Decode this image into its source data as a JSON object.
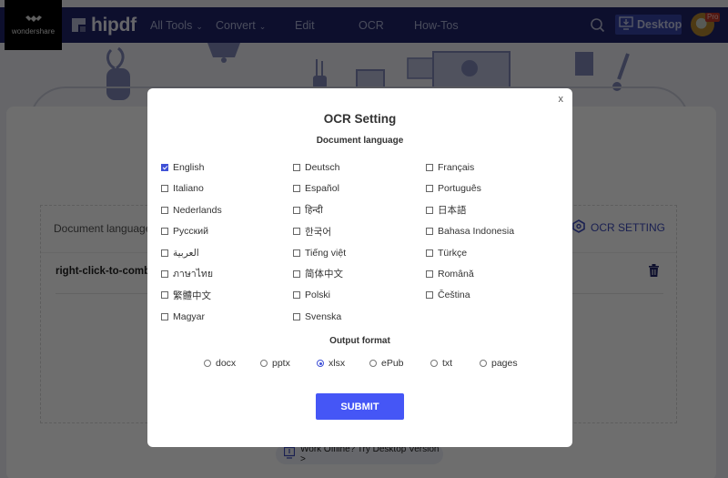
{
  "topbar": {
    "company_logo_text": "wondershare",
    "brand_name": "hipdf",
    "nav": [
      {
        "label": "All Tools",
        "has_dropdown": true
      },
      {
        "label": "Convert",
        "has_dropdown": true
      },
      {
        "label": "Edit",
        "has_dropdown": false
      },
      {
        "label": "OCR",
        "has_dropdown": false
      },
      {
        "label": "How-Tos",
        "has_dropdown": false
      }
    ],
    "desktop_button_label": "Desktop",
    "pro_badge": "Pro",
    "icons": {
      "search": "search-icon",
      "desktop": "download-monitor-icon",
      "avatar": "user-avatar"
    }
  },
  "background": {
    "table_header_language": "Document language",
    "ocr_setting_label": "OCR SETTING",
    "file_name": "right-click-to-comb",
    "offline_link": "Work Offline? Try Desktop Version >"
  },
  "modal": {
    "title": "OCR Setting",
    "close_label": "x",
    "language_section_title": "Document language",
    "languages": [
      {
        "label": "English",
        "checked": true
      },
      {
        "label": "Deutsch",
        "checked": false
      },
      {
        "label": "Français",
        "checked": false
      },
      {
        "label": "Italiano",
        "checked": false
      },
      {
        "label": "Español",
        "checked": false
      },
      {
        "label": "Português",
        "checked": false
      },
      {
        "label": "Nederlands",
        "checked": false
      },
      {
        "label": "हिन्दी",
        "checked": false
      },
      {
        "label": "日本語",
        "checked": false
      },
      {
        "label": "Русский",
        "checked": false
      },
      {
        "label": "한국어",
        "checked": false
      },
      {
        "label": "Bahasa Indonesia",
        "checked": false
      },
      {
        "label": "العربية",
        "checked": false
      },
      {
        "label": "Tiếng việt",
        "checked": false
      },
      {
        "label": "Türkçe",
        "checked": false
      },
      {
        "label": "ภาษาไทย",
        "checked": false
      },
      {
        "label": "简体中文",
        "checked": false
      },
      {
        "label": "Română",
        "checked": false
      },
      {
        "label": "繁體中文",
        "checked": false
      },
      {
        "label": "Polski",
        "checked": false
      },
      {
        "label": "Čeština",
        "checked": false
      },
      {
        "label": "Magyar",
        "checked": false
      },
      {
        "label": "Svenska",
        "checked": false
      }
    ],
    "format_section_title": "Output format",
    "formats": [
      {
        "label": "docx",
        "checked": false
      },
      {
        "label": "pptx",
        "checked": false
      },
      {
        "label": "xlsx",
        "checked": true
      },
      {
        "label": "ePub",
        "checked": false
      },
      {
        "label": "txt",
        "checked": false
      },
      {
        "label": "pages",
        "checked": false
      }
    ],
    "submit_label": "SUBMIT"
  },
  "colors": {
    "nav_bg": "#1f2468",
    "accent": "#4556f6",
    "checkbox_checked": "#3f51d6"
  }
}
